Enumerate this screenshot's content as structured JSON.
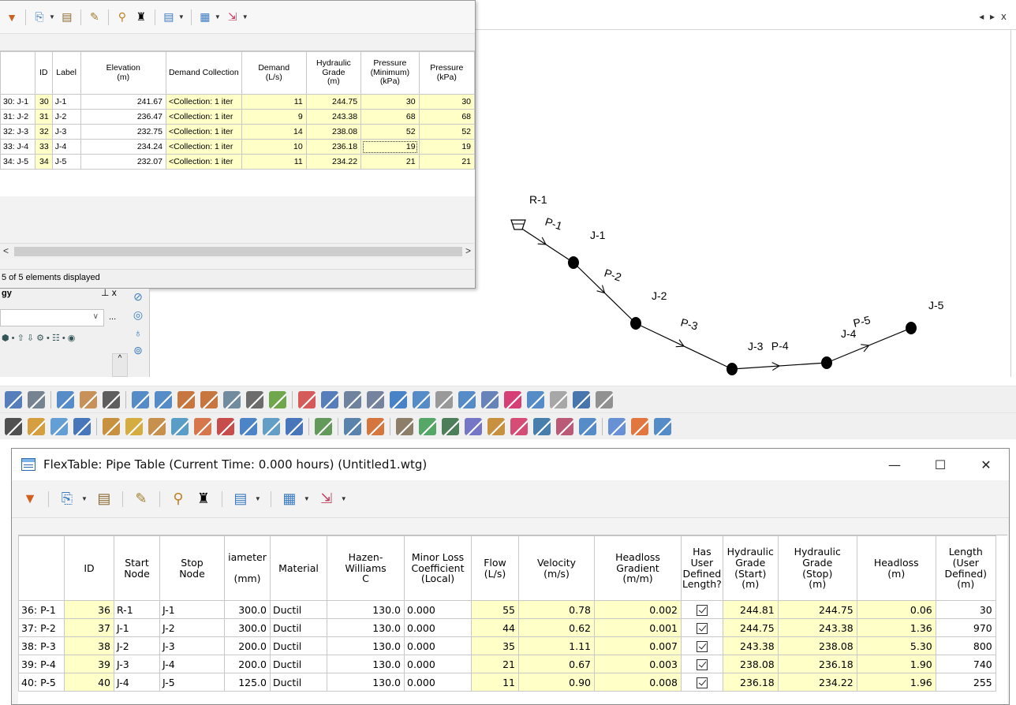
{
  "canvas": {
    "tab_controls": "◂ ▸ x",
    "nodes": [
      {
        "label": "R-1",
        "type": "reservoir"
      },
      {
        "label": "J-1",
        "type": "junction"
      },
      {
        "label": "J-2",
        "type": "junction"
      },
      {
        "label": "J-3",
        "type": "junction"
      },
      {
        "label": "J-4",
        "type": "junction"
      },
      {
        "label": "J-5",
        "type": "junction"
      }
    ],
    "pipes": [
      "P-1",
      "P-2",
      "P-3",
      "P-4",
      "P-5"
    ]
  },
  "junction_table": {
    "columns": [
      "",
      "ID",
      "Label",
      "Elevation\n(m)",
      "Demand Collection",
      "Demand\n(L/s)",
      "Hydraulic\nGrade\n(m)",
      "Pressure\n(Minimum)\n(kPa)",
      "Pressure\n(kPa)"
    ],
    "rows": [
      [
        "30: J-1",
        "30",
        "J-1",
        "241.67",
        "<Collection: 1 iter",
        "11",
        "244.75",
        "30",
        "30"
      ],
      [
        "31: J-2",
        "31",
        "J-2",
        "236.47",
        "<Collection: 1 iter",
        "9",
        "243.38",
        "68",
        "68"
      ],
      [
        "32: J-3",
        "32",
        "J-3",
        "232.75",
        "<Collection: 1 iter",
        "14",
        "238.08",
        "52",
        "52"
      ],
      [
        "33: J-4",
        "33",
        "J-4",
        "234.24",
        "<Collection: 1 iter",
        "10",
        "236.18",
        "19",
        "19"
      ],
      [
        "34: J-5",
        "34",
        "J-5",
        "232.07",
        "<Collection: 1 iter",
        "11",
        "234.22",
        "21",
        "21"
      ]
    ],
    "status": "5 of 5 elements displayed",
    "scroll_left": "<",
    "scroll_right": ">"
  },
  "left_panel": {
    "title": "gy",
    "pin": "⊥ x",
    "combo_arrow": "∨",
    "combo_more": "...",
    "row_icons": "⬢ • ⇧ ⇩ ⚙ • ☷ • ◉",
    "scroll_up": "^"
  },
  "pipe_table": {
    "title": "FlexTable: Pipe Table (Current Time:  0.000 hours) (Untitled1.wtg)",
    "win_minimize": "—",
    "win_maximize": "☐",
    "win_close": "✕",
    "columns": [
      "",
      "ID",
      "Start\nNode",
      "Stop\nNode",
      "iameter\n\n(mm)",
      "Material",
      "Hazen-Williams\nC",
      "Minor Loss\nCoefficient\n(Local)",
      "Flow\n(L/s)",
      "Velocity\n(m/s)",
      "Headloss\nGradient\n(m/m)",
      "Has\nUser\nDefined\nLength?",
      "Hydraulic\nGrade\n(Start)\n(m)",
      "Hydraulic\nGrade\n(Stop)\n(m)",
      "Headloss\n(m)",
      "Length\n(User\nDefined)\n(m)"
    ],
    "rows": [
      [
        "36: P-1",
        "36",
        "R-1",
        "J-1",
        "300.0",
        "Ductil",
        "130.0",
        "0.000",
        "55",
        "0.78",
        "0.002",
        "true",
        "244.81",
        "244.75",
        "0.06",
        "30"
      ],
      [
        "37: P-2",
        "37",
        "J-1",
        "J-2",
        "300.0",
        "Ductil",
        "130.0",
        "0.000",
        "44",
        "0.62",
        "0.001",
        "true",
        "244.75",
        "243.38",
        "1.36",
        "970"
      ],
      [
        "38: P-3",
        "38",
        "J-2",
        "J-3",
        "200.0",
        "Ductil",
        "130.0",
        "0.000",
        "35",
        "1.11",
        "0.007",
        "true",
        "243.38",
        "238.08",
        "5.30",
        "800"
      ],
      [
        "39: P-4",
        "39",
        "J-3",
        "J-4",
        "200.0",
        "Ductil",
        "130.0",
        "0.000",
        "21",
        "0.67",
        "0.003",
        "true",
        "238.08",
        "236.18",
        "1.90",
        "740"
      ],
      [
        "40: P-5",
        "40",
        "J-4",
        "J-5",
        "125.0",
        "Ductil",
        "130.0",
        "0.000",
        "11",
        "0.90",
        "0.008",
        "true",
        "236.18",
        "234.22",
        "1.96",
        "255"
      ]
    ]
  },
  "colors": {
    "cell_yellow": "#ffffc8",
    "accent_blue": "#2a6ab0"
  }
}
